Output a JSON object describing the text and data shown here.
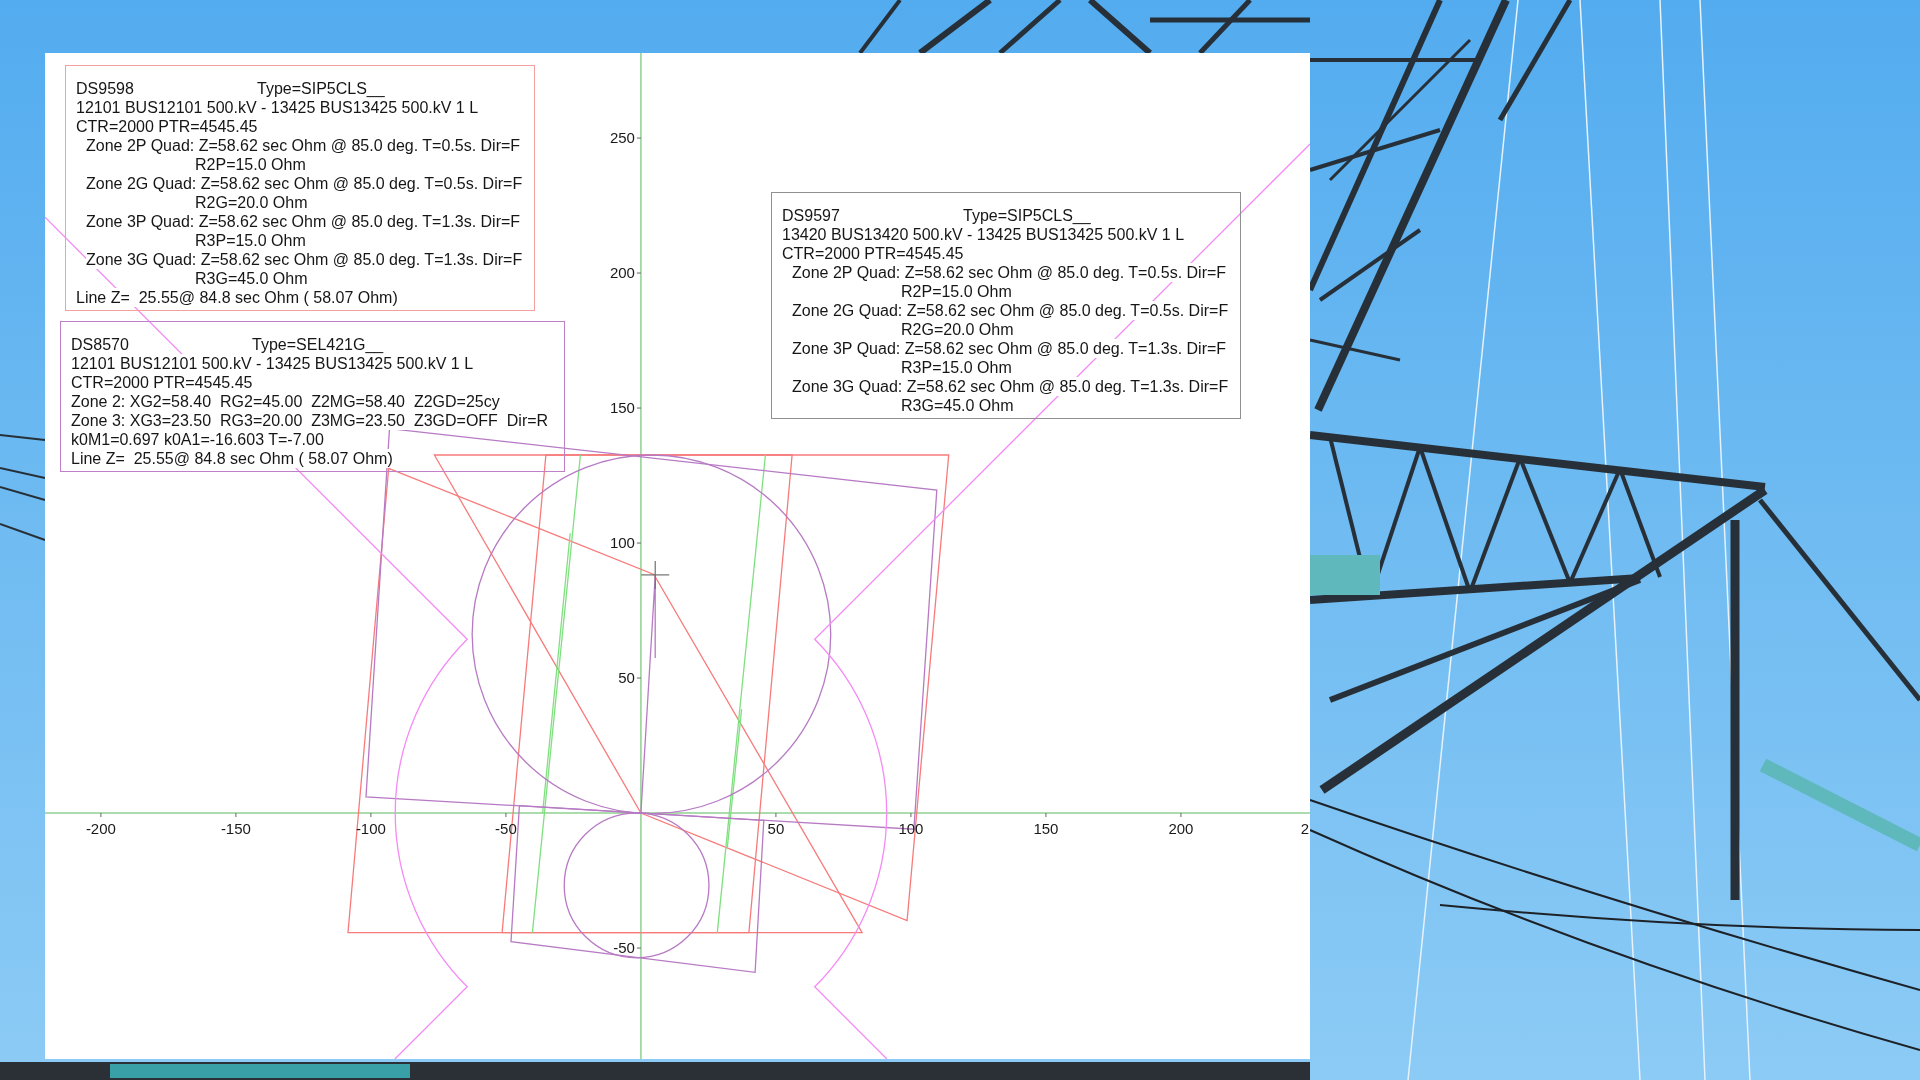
{
  "relay_boxes": [
    {
      "color": "#f4a0a0",
      "device": "DS9598",
      "type": "Type=SIP5CLS__",
      "lines": [
        {
          "kind": "plain",
          "text": "12101 BUS12101 500.kV - 13425 BUS13425 500.kV 1 L"
        },
        {
          "kind": "plain",
          "text": "CTR=2000 PTR=4545.45"
        },
        {
          "kind": "zone",
          "text": "Zone 2P Quad: Z=58.62 sec Ohm @ 85.0 deg. T=0.5s. Dir=F"
        },
        {
          "kind": "setting",
          "text": "R2P=15.0 Ohm"
        },
        {
          "kind": "zone",
          "text": "Zone 2G Quad: Z=58.62 sec Ohm @ 85.0 deg. T=0.5s. Dir=F"
        },
        {
          "kind": "setting",
          "text": "R2G=20.0 Ohm"
        },
        {
          "kind": "zone",
          "text": "Zone 3P Quad: Z=58.62 sec Ohm @ 85.0 deg. T=1.3s. Dir=F"
        },
        {
          "kind": "setting",
          "text": "R3P=15.0 Ohm"
        },
        {
          "kind": "zone",
          "text": "Zone 3G Quad: Z=58.62 sec Ohm @ 85.0 deg. T=1.3s. Dir=F"
        },
        {
          "kind": "setting",
          "text": "R3G=45.0 Ohm"
        },
        {
          "kind": "plain",
          "text": "Line Z=  25.55@ 84.8 sec Ohm ( 58.07 Ohm)"
        }
      ]
    },
    {
      "color": "#c080c8",
      "device": "DS8570",
      "type": "Type=SEL421G__",
      "lines": [
        {
          "kind": "plain",
          "text": "12101 BUS12101 500.kV - 13425 BUS13425 500.kV 1 L"
        },
        {
          "kind": "plain",
          "text": "CTR=2000 PTR=4545.45"
        },
        {
          "kind": "plain",
          "text": "Zone 2: XG2=58.40  RG2=45.00  Z2MG=58.40  Z2GD=25cy"
        },
        {
          "kind": "plain",
          "text": "Zone 3: XG3=23.50  RG3=20.00  Z3MG=23.50  Z3GD=OFF  Dir=R"
        },
        {
          "kind": "plain",
          "text": "k0M1=0.697 k0A1=-16.603 T=-7.00"
        },
        {
          "kind": "plain",
          "text": "Line Z=  25.55@ 84.8 sec Ohm ( 58.07 Ohm)"
        }
      ]
    },
    {
      "color": "#909090",
      "device": "DS9597",
      "type": "Type=SIP5CLS__",
      "lines": [
        {
          "kind": "plain",
          "text": "13420 BUS13420 500.kV - 13425 BUS13425 500.kV 1 L"
        },
        {
          "kind": "plain",
          "text": "CTR=2000 PTR=4545.45"
        },
        {
          "kind": "zone",
          "text": "Zone 2P Quad: Z=58.62 sec Ohm @ 85.0 deg. T=0.5s. Dir=F"
        },
        {
          "kind": "setting",
          "text": "R2P=15.0 Ohm"
        },
        {
          "kind": "zone",
          "text": "Zone 2G Quad: Z=58.62 sec Ohm @ 85.0 deg. T=0.5s. Dir=F"
        },
        {
          "kind": "setting",
          "text": "R2G=20.0 Ohm"
        },
        {
          "kind": "zone",
          "text": "Zone 3P Quad: Z=58.62 sec Ohm @ 85.0 deg. T=1.3s. Dir=F"
        },
        {
          "kind": "setting",
          "text": "R3P=15.0 Ohm"
        },
        {
          "kind": "zone",
          "text": "Zone 3G Quad: Z=58.62 sec Ohm @ 85.0 deg. T=1.3s. Dir=F"
        },
        {
          "kind": "setting",
          "text": "R3G=45.0 Ohm"
        }
      ]
    }
  ],
  "impedance_plot": {
    "x_tick_labels": [
      "-200",
      "-150",
      "-100",
      "-50",
      "50",
      "100",
      "150",
      "200",
      "2"
    ],
    "y_tick_labels": [
      "250",
      "200",
      "150",
      "100",
      "50",
      "-50"
    ]
  }
}
